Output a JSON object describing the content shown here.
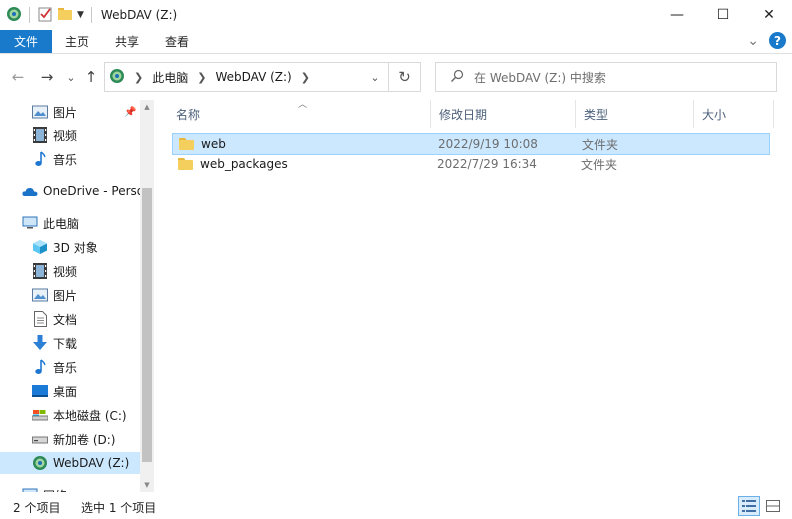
{
  "window": {
    "title": "WebDAV (Z:)",
    "controls": {
      "minimize": "—",
      "maximize": "☐",
      "close": "✕"
    }
  },
  "ribbon": {
    "tabs": [
      "文件",
      "主页",
      "共享",
      "查看"
    ],
    "expand_glyph": "⌄",
    "help_label": "?"
  },
  "navigation": {
    "back_glyph": "←",
    "forward_glyph": "→",
    "recent_glyph": "⌄",
    "up_glyph": "↑",
    "breadcrumb": [
      "此电脑",
      "WebDAV (Z:)"
    ],
    "refresh_glyph": "↻",
    "search_placeholder": "在 WebDAV (Z:) 中搜索"
  },
  "nav_pane": {
    "items": [
      {
        "label": "图片",
        "icon": "pictures-icon"
      },
      {
        "label": "视频",
        "icon": "video-icon"
      },
      {
        "label": "音乐",
        "icon": "music-icon"
      },
      {
        "label": "OneDrive - Perso",
        "icon": "onedrive-icon"
      },
      {
        "label": "此电脑",
        "icon": "this-pc-icon"
      },
      {
        "label": "3D 对象",
        "icon": "3d-objects-icon"
      },
      {
        "label": "视频",
        "icon": "video-icon"
      },
      {
        "label": "图片",
        "icon": "pictures-icon"
      },
      {
        "label": "文档",
        "icon": "documents-icon"
      },
      {
        "label": "下载",
        "icon": "download-icon"
      },
      {
        "label": "音乐",
        "icon": "music-icon"
      },
      {
        "label": "桌面",
        "icon": "desktop-icon"
      },
      {
        "label": "本地磁盘 (C:)",
        "icon": "local-disk-icon"
      },
      {
        "label": "新加卷 (D:)",
        "icon": "drive-icon"
      },
      {
        "label": "WebDAV (Z:)",
        "icon": "webdav-drive-icon"
      },
      {
        "label": "网络",
        "icon": "network-icon"
      }
    ]
  },
  "file_list": {
    "columns": [
      "名称",
      "修改日期",
      "类型",
      "大小"
    ],
    "rows": [
      {
        "name": "web",
        "modified": "2022/9/19 10:08",
        "type": "文件夹",
        "size": ""
      },
      {
        "name": "web_packages",
        "modified": "2022/7/29 16:34",
        "type": "文件夹",
        "size": ""
      }
    ]
  },
  "status_bar": {
    "item_count": "2 个项目",
    "selected_count": "选中 1 个项目"
  }
}
